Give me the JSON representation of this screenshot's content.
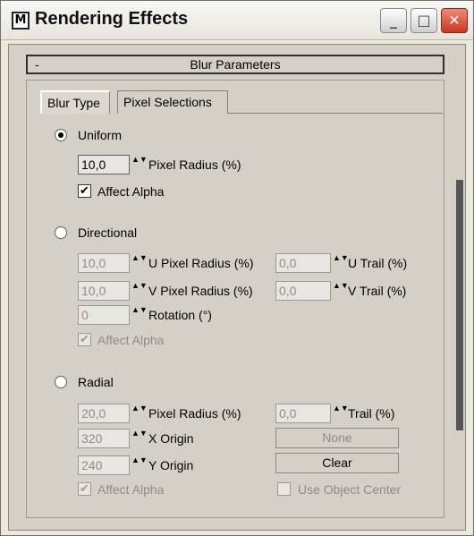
{
  "window": {
    "title": "Rendering Effects"
  },
  "rollout": {
    "collapse_glyph": "-",
    "title": "Blur Parameters"
  },
  "tabs": [
    "Blur Type",
    "Pixel Selections"
  ],
  "uniform": {
    "label": "Uniform",
    "pixel_radius": {
      "value": "10,0",
      "label": "Pixel Radius (%)"
    },
    "affect_alpha": "Affect Alpha"
  },
  "directional": {
    "label": "Directional",
    "u_pixel_radius": {
      "value": "10,0",
      "label": "U Pixel Radius (%)"
    },
    "u_trail": {
      "value": "0,0",
      "label": "U Trail (%)"
    },
    "v_pixel_radius": {
      "value": "10,0",
      "label": "V Pixel Radius (%)"
    },
    "v_trail": {
      "value": "0,0",
      "label": "V Trail (%)"
    },
    "rotation": {
      "value": "0",
      "label": "Rotation (°)"
    },
    "affect_alpha": "Affect Alpha"
  },
  "radial": {
    "label": "Radial",
    "pixel_radius": {
      "value": "20,0",
      "label": "Pixel Radius (%)"
    },
    "trail": {
      "value": "0,0",
      "label": "Trail (%)"
    },
    "x_origin": {
      "value": "320",
      "label": "X Origin"
    },
    "y_origin": {
      "value": "240",
      "label": "Y Origin"
    },
    "none_button": "None",
    "clear_button": "Clear",
    "affect_alpha": "Affect Alpha",
    "use_object_center": "Use Object Center"
  },
  "glyphs": {
    "check": "✔",
    "minimize": "_",
    "maximize": "□",
    "close": "✕",
    "spin": "▲▼",
    "app_icon": "M"
  }
}
